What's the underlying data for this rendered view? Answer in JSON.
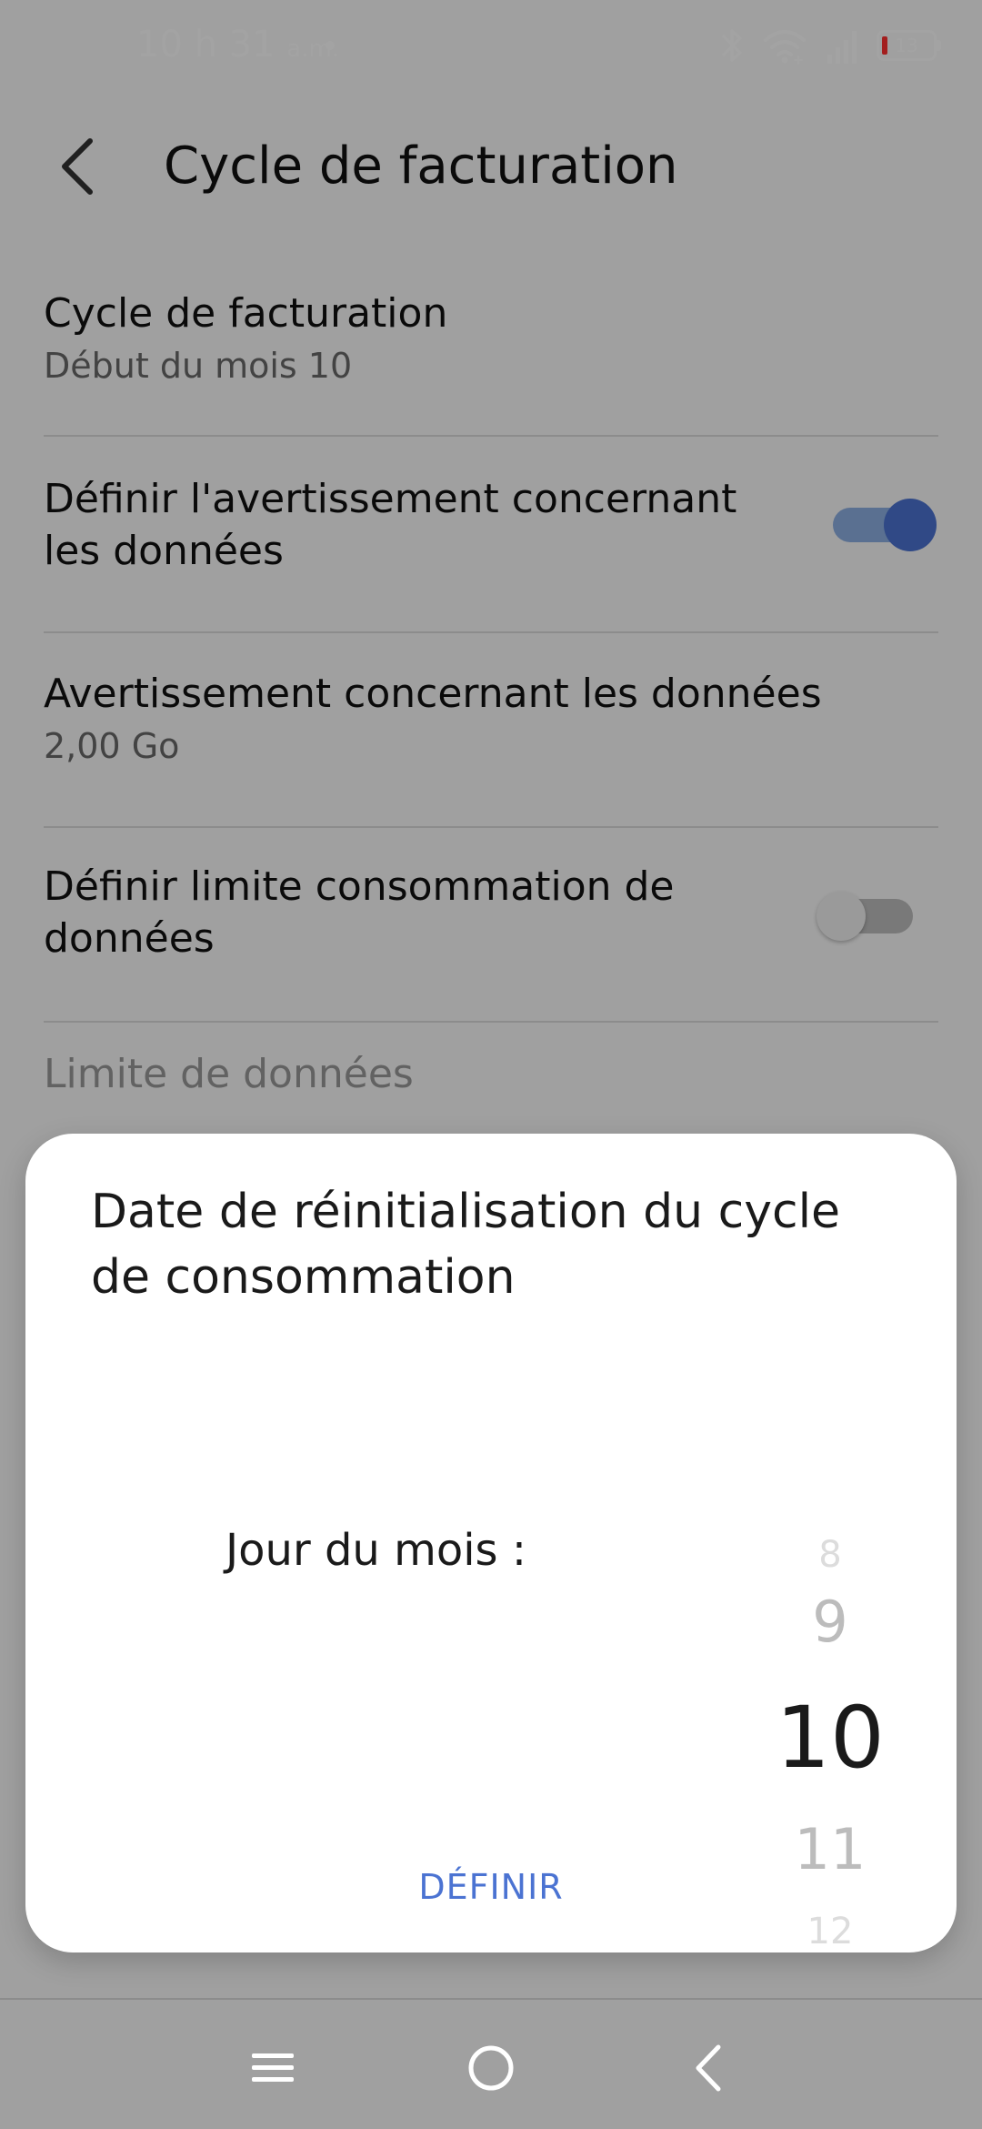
{
  "status_bar": {
    "time": "10 h 31",
    "ampm": "a.m.",
    "battery_level": "13",
    "icons": [
      "bluetooth-icon",
      "wifi-icon",
      "cellular-signal-icon",
      "battery-icon"
    ]
  },
  "header": {
    "title": "Cycle de facturation",
    "back_icon": "chevron-left-icon"
  },
  "settings": {
    "billing_cycle": {
      "title": "Cycle de facturation",
      "subtitle": "Début du mois 10"
    },
    "data_warning_toggle": {
      "title": "Définir l'avertissement concernant les données",
      "enabled": true
    },
    "data_warning": {
      "title": "Avertissement concernant les données",
      "subtitle": "2,00 Go"
    },
    "data_limit_toggle": {
      "title": "Définir limite consommation de données",
      "enabled": false
    },
    "data_limit": {
      "title": "Limite de données"
    }
  },
  "dialog": {
    "title": "Date de réinitialisation du cycle de consommation",
    "picker_label": "Jour du mois :",
    "picker_values": [
      "8",
      "9",
      "10",
      "11",
      "12"
    ],
    "selected_value": "10",
    "action_label": "DÉFINIR"
  },
  "nav_bar": {
    "icons": [
      "menu-icon",
      "home-icon",
      "back-icon"
    ]
  },
  "colors": {
    "accent": "#4b73d2",
    "toggle_on_track": "#8db0e3",
    "scrim": "rgba(0,0,0,0.36)"
  }
}
